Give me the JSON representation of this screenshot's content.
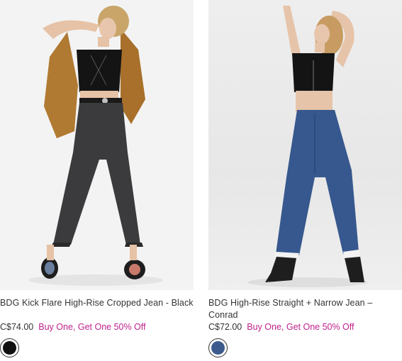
{
  "products": [
    {
      "title": "BDG Kick Flare High-Rise Cropped Jean - Black",
      "price": "C$74.00",
      "promo": "Buy One, Get One 50% Off",
      "swatch_color": "#111111"
    },
    {
      "title": "BDG High-Rise Straight + Narrow Jean – Conrad",
      "price": "C$72.00",
      "promo": "Buy One, Get One 50% Off",
      "swatch_color": "#3d5a8c"
    }
  ],
  "colors": {
    "promo": "#c0228c",
    "text": "#333333"
  }
}
